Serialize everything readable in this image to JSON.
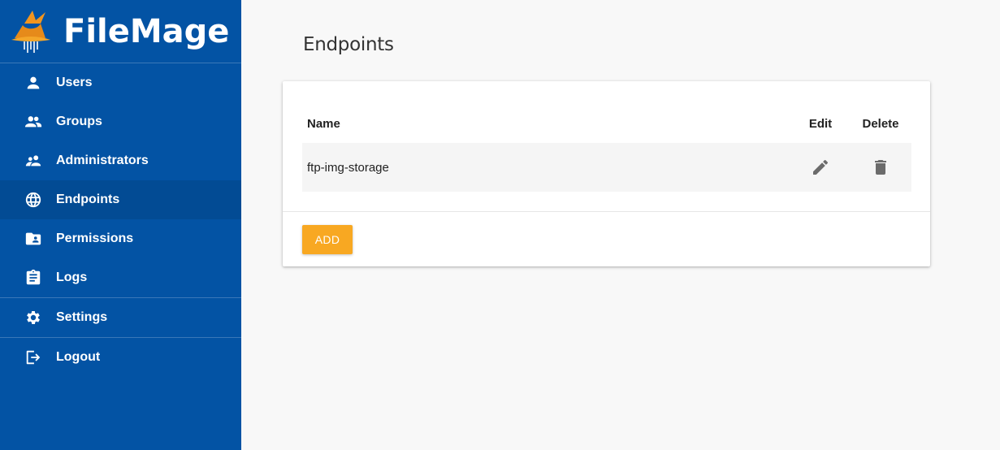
{
  "brand": {
    "name": "FileMage"
  },
  "sidebar": {
    "items": [
      {
        "label": "Users",
        "icon": "person-icon"
      },
      {
        "label": "Groups",
        "icon": "group-icon"
      },
      {
        "label": "Administrators",
        "icon": "supervisor-icon"
      },
      {
        "label": "Endpoints",
        "icon": "globe-icon",
        "active": true
      },
      {
        "label": "Permissions",
        "icon": "folder-shared-icon"
      },
      {
        "label": "Logs",
        "icon": "clipboard-icon"
      },
      {
        "label": "Settings",
        "icon": "gear-icon"
      },
      {
        "label": "Logout",
        "icon": "logout-icon"
      }
    ]
  },
  "main": {
    "title": "Endpoints",
    "table": {
      "headers": {
        "name": "Name",
        "edit": "Edit",
        "delete": "Delete"
      },
      "rows": [
        {
          "name": "ftp-img-storage"
        }
      ]
    },
    "add_label": "ADD"
  },
  "colors": {
    "sidebar": "#0353a4",
    "active": "#024b94",
    "accent": "#f8a822",
    "background": "#f8f8f8"
  }
}
